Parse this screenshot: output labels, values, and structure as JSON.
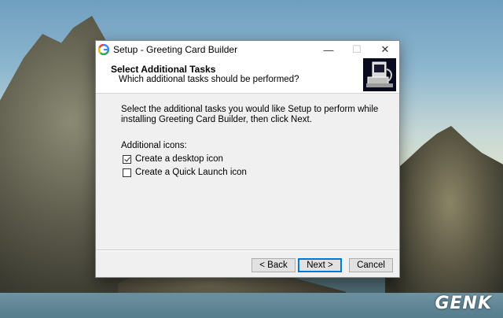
{
  "window": {
    "title": "Setup - Greeting Card Builder",
    "controls": {
      "minimize": "—",
      "maximize": "☐",
      "close": "✕"
    }
  },
  "header": {
    "title": "Select Additional Tasks",
    "subtitle": "Which additional tasks should be performed?"
  },
  "body": {
    "description": "Select the additional tasks you would like Setup to perform while installing Greeting Card Builder, then click Next.",
    "section_label": "Additional icons:",
    "tasks": [
      {
        "label": "Create a desktop icon",
        "checked": true
      },
      {
        "label": "Create a Quick Launch icon",
        "checked": false
      }
    ]
  },
  "buttons": {
    "back": "< Back",
    "next": "Next >",
    "cancel": "Cancel"
  },
  "watermark": "GENK",
  "colors": {
    "accent": "#0078d7"
  }
}
